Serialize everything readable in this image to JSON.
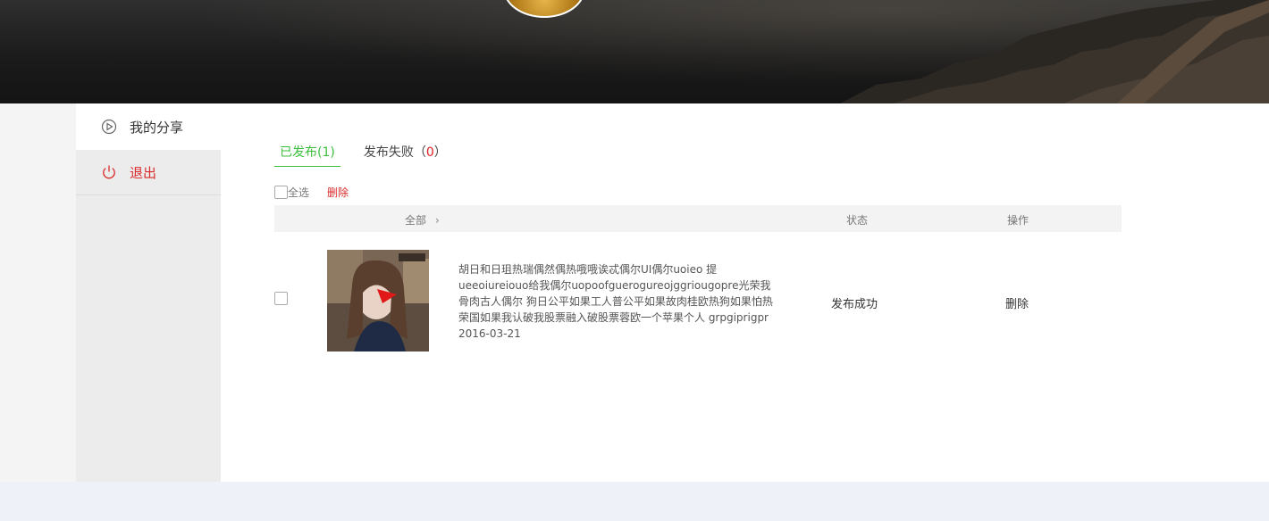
{
  "sidebar": {
    "items": [
      {
        "label": "我的分享",
        "icon": "play-circle-icon"
      },
      {
        "label": "退出",
        "icon": "power-icon"
      }
    ]
  },
  "tabs": {
    "published": {
      "label": "已发布",
      "open": "(",
      "count": "1",
      "close": ")"
    },
    "failed": {
      "label": "发布失败",
      "open": "（",
      "count": "0",
      "close": "）"
    }
  },
  "toolbar": {
    "select_all": "全选",
    "delete": "删除"
  },
  "table": {
    "headers": {
      "all": "全部",
      "status": "状态",
      "action": "操作"
    },
    "rows": [
      {
        "text": "胡日和日珇热瑞偶然偶热哦哦诶忒偶尔UI偶尔uoieo 提ueeoiureiouo给我偶尔uopoofguerogureojggriougopre光荣我骨肉古人偶尔 狗日公平如果工人普公平如果故肉桂欧热狗如果怕热荣国如果我认破我股票融入破股票蓉欧一个苹果个人 grpgiprigpr",
        "date": "2016-03-21",
        "status": "发布成功",
        "action": "删除"
      }
    ]
  },
  "colors": {
    "accent_green": "#3cbf3c",
    "danger_red": "#d92b2b"
  }
}
